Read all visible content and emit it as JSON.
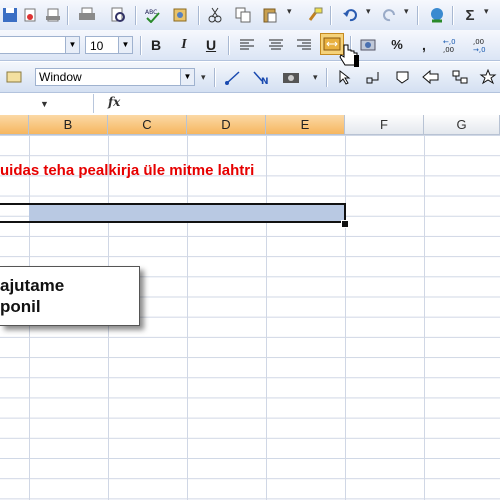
{
  "toolbar": {
    "font_size": "10",
    "bold_label": "B",
    "italic_label": "I",
    "underline_label": "U",
    "percent_label": "%",
    "comma_label": ",",
    "inc_decimal_label": "+,0\n,00",
    "dec_decimal_label": ",00\n+,0",
    "sigma_label": "Σ",
    "window_select": "Window"
  },
  "formula_bar": {
    "fx_label": "fx"
  },
  "columns": [
    "B",
    "C",
    "D",
    "E",
    "F",
    "G"
  ],
  "sheet": {
    "title_text": "uidas teha pealkirja üle mitme lahtri",
    "callout_line1": "ajutame",
    "callout_line2": "ponil"
  },
  "colors": {
    "title": "#e60000",
    "selected_header": "#f6b65f",
    "selection_fill": "#b9c9e3"
  }
}
